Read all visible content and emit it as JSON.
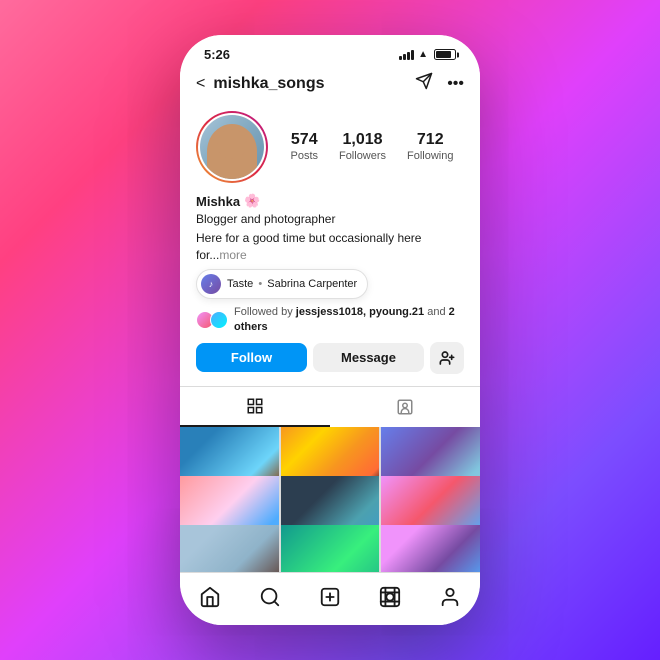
{
  "background": {
    "gradient": "linear-gradient(135deg, #ff6b9d 0%, #ff4081 20%, #e040fb 50%, #7c4dff 80%, #651fff 100%)"
  },
  "statusBar": {
    "time": "5:26",
    "signal": "signal",
    "wifi": "wifi",
    "battery": "battery"
  },
  "header": {
    "back_label": "<",
    "username": "mishka_songs",
    "send_icon": "send",
    "more_icon": "more"
  },
  "profile": {
    "name": "Mishka",
    "emoji": "🌸",
    "bio_line1": "Blogger and photographer",
    "bio_line2": "Here for a good time but occasionally here for...",
    "bio_more": "more",
    "stats": [
      {
        "value": "574",
        "label": "Posts"
      },
      {
        "value": "1,018",
        "label": "Followers"
      },
      {
        "value": "712",
        "label": "Following"
      }
    ],
    "music": {
      "icon": "♪",
      "label": "Taste",
      "separator": "•",
      "song": "Sabrina Carpenter"
    },
    "followed_by": {
      "text_prefix": "Followed by ",
      "users": "jessjess1018, pyoung.21",
      "text_suffix": " and ",
      "others": "2 others"
    }
  },
  "actions": {
    "follow_label": "Follow",
    "message_label": "Message",
    "add_person_icon": "add-person"
  },
  "profileTabs": {
    "grid_tab": "grid",
    "tag_tab": "tag"
  },
  "bottomNav": {
    "home_icon": "home",
    "search_icon": "search",
    "add_icon": "add",
    "reels_icon": "reels",
    "profile_icon": "profile"
  }
}
